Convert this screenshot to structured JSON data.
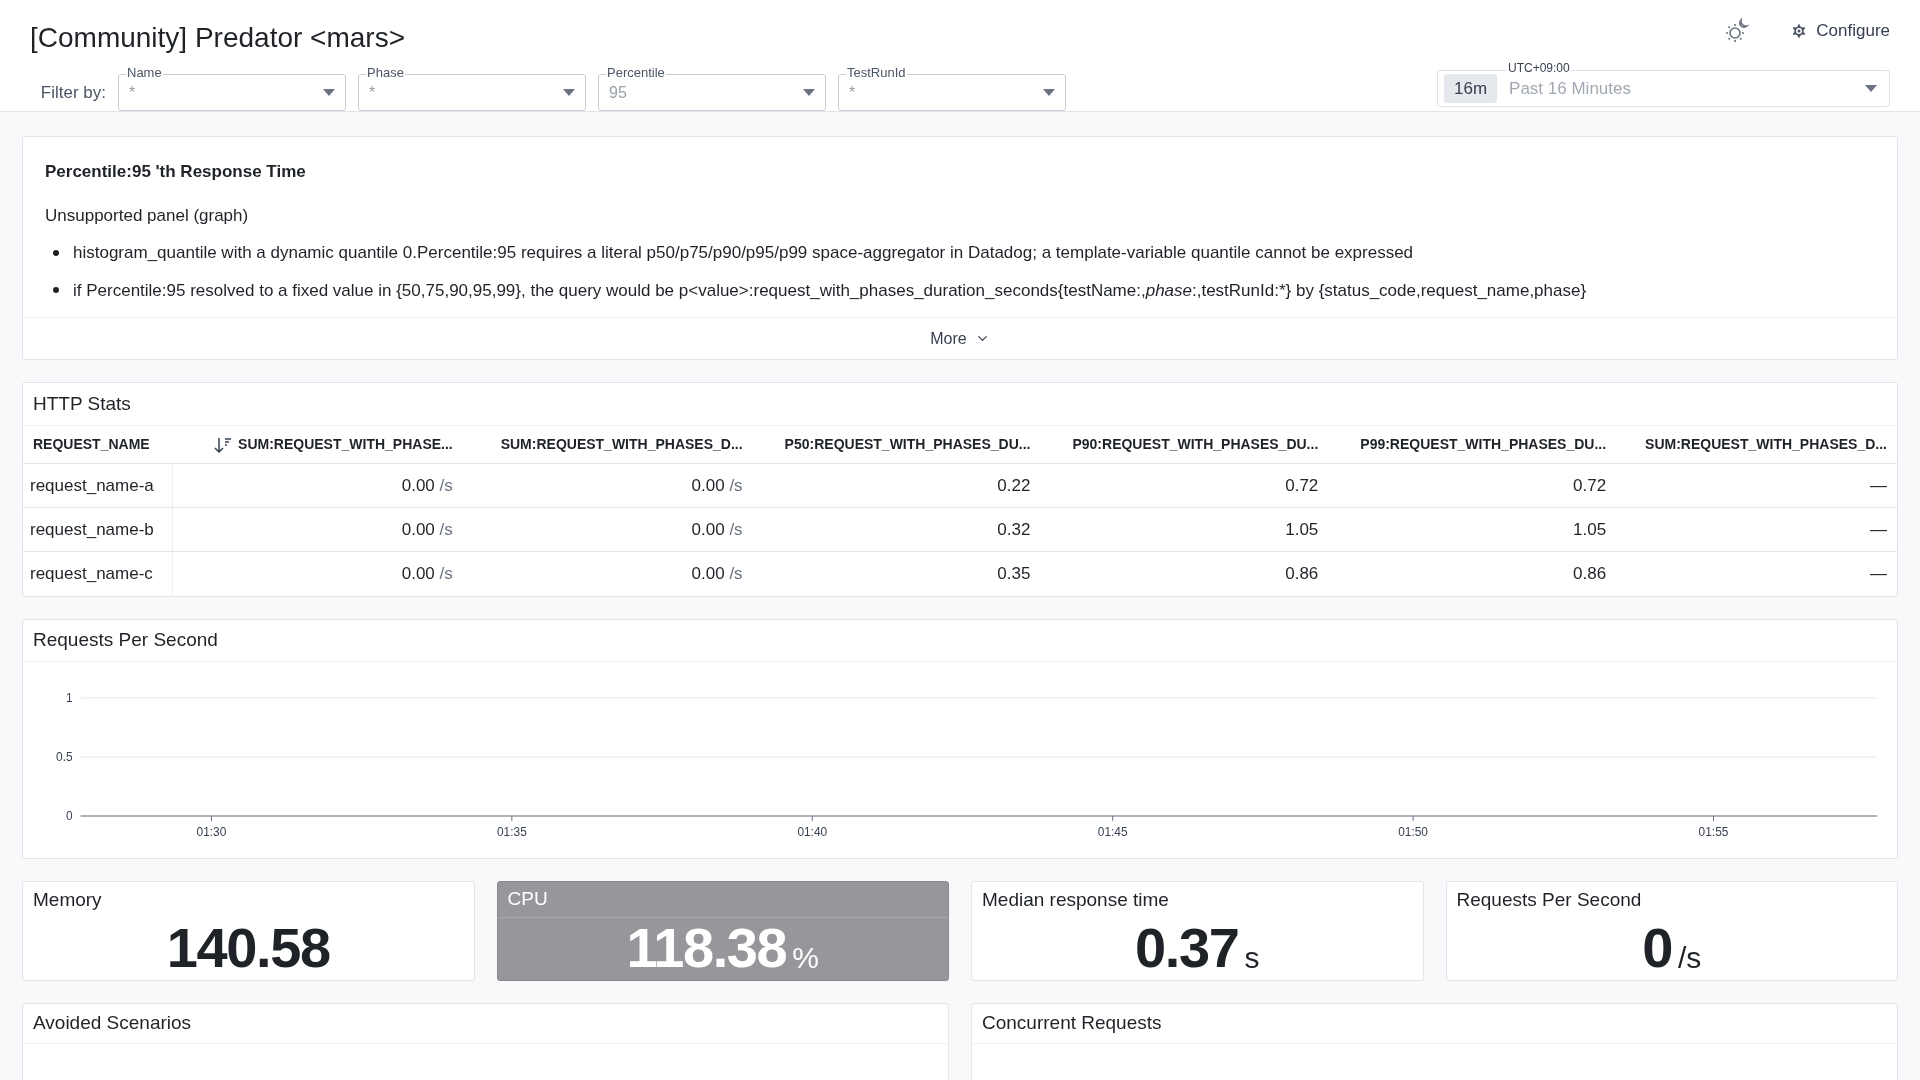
{
  "header": {
    "title": "[Community] Predator <mars>",
    "configure": "Configure",
    "filter_label": "Filter by:",
    "filters": [
      {
        "label": "Name",
        "value": "*"
      },
      {
        "label": "Phase",
        "value": "*"
      },
      {
        "label": "Percentile",
        "value": "95"
      },
      {
        "label": "TestRunId",
        "value": "*"
      }
    ],
    "time": {
      "label": "UTC+09:00",
      "badge": "16m",
      "value": "Past 16 Minutes"
    }
  },
  "notice_panel": {
    "title": "Percentile:95 'th Response Time",
    "subtitle": "Unsupported panel (graph)",
    "bullets": [
      "histogram_quantile with a dynamic quantile 0.Percentile:95 requires a literal p50/p75/p90/p95/p99 space-aggregator in Datadog; a template-variable quantile cannot be expressed",
      "if Percentile:95 resolved to a fixed value in {50,75,90,95,99}, the query would be p<value>:request_with_phases_duration_seconds{testName:,*phase*:,testRunId:*} by {status_code,request_name,phase}"
    ],
    "more": "More"
  },
  "table": {
    "title": "HTTP Stats",
    "columns": [
      {
        "label": "REQUEST_NAME",
        "sorted": false
      },
      {
        "label": "SUM:REQUEST_WITH_PHASE...",
        "sorted": true
      },
      {
        "label": "SUM:REQUEST_WITH_PHASES_D...",
        "sorted": false
      },
      {
        "label": "P50:REQUEST_WITH_PHASES_DU...",
        "sorted": false
      },
      {
        "label": "P90:REQUEST_WITH_PHASES_DU...",
        "sorted": false
      },
      {
        "label": "P99:REQUEST_WITH_PHASES_DU...",
        "sorted": false
      },
      {
        "label": "SUM:REQUEST_WITH_PHASES_D...",
        "sorted": false
      }
    ],
    "rows": [
      {
        "cells": [
          {
            "value": "request_name-a"
          },
          {
            "value": "0.00",
            "unit": "/s"
          },
          {
            "value": "0.00",
            "unit": "/s"
          },
          {
            "value": "0.22"
          },
          {
            "value": "0.72"
          },
          {
            "value": "0.72"
          },
          {
            "value": "—"
          }
        ]
      },
      {
        "cells": [
          {
            "value": "request_name-b"
          },
          {
            "value": "0.00",
            "unit": "/s"
          },
          {
            "value": "0.00",
            "unit": "/s"
          },
          {
            "value": "0.32"
          },
          {
            "value": "1.05"
          },
          {
            "value": "1.05"
          },
          {
            "value": "—"
          }
        ]
      },
      {
        "cells": [
          {
            "value": "request_name-c"
          },
          {
            "value": "0.00",
            "unit": "/s"
          },
          {
            "value": "0.00",
            "unit": "/s"
          },
          {
            "value": "0.35"
          },
          {
            "value": "0.86"
          },
          {
            "value": "0.86"
          },
          {
            "value": "—"
          }
        ]
      }
    ]
  },
  "chart_panel": {
    "title": "Requests Per Second",
    "chart_data": {
      "type": "line",
      "x": [
        "01:30",
        "01:35",
        "01:40",
        "01:45",
        "01:50",
        "01:55"
      ],
      "ylim": [
        0,
        1
      ],
      "yticks": [
        0,
        {
          "value": 0.5,
          "label": "0.5"
        },
        1
      ]
    }
  },
  "stats": [
    {
      "title": "Memory",
      "value": "140.58",
      "highlighted": false
    },
    {
      "title": "CPU",
      "value": "118.38",
      "unit": "%",
      "highlighted": true
    },
    {
      "title": "Median response time",
      "value": "0.37",
      "unit": "s",
      "highlighted": false
    },
    {
      "title": "Requests Per Second",
      "value": "0",
      "unit": "/s",
      "highlighted": false
    }
  ],
  "bottom_panels": [
    {
      "title": "Avoided Scenarios"
    },
    {
      "title": "Concurrent Requests"
    }
  ]
}
